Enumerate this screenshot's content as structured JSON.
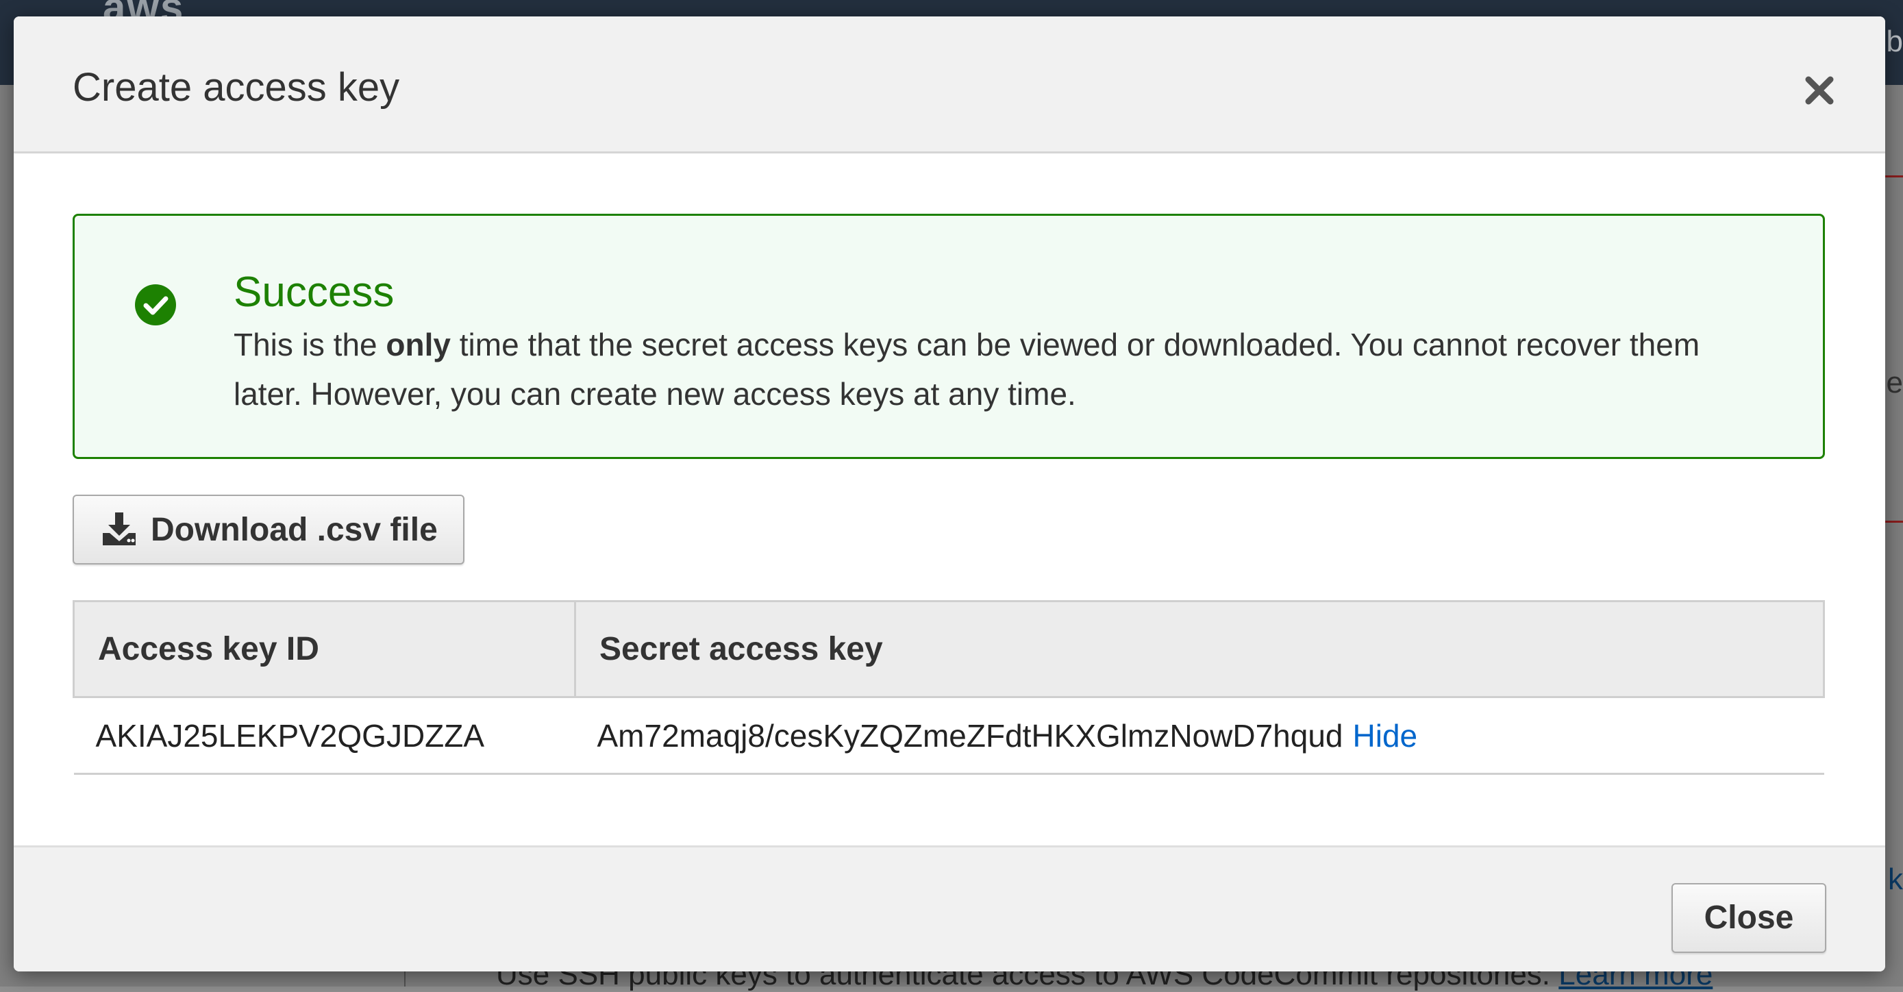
{
  "background": {
    "logo": "aws",
    "topbar_text": "b",
    "side_text": "e",
    "side_link": "k",
    "bottom_text": "Use SSH public keys to authenticate access to AWS CodeCommit repositories.",
    "bottom_link": "Learn more"
  },
  "modal": {
    "title": "Create access key",
    "close_icon": "close-icon",
    "alert": {
      "icon": "check-circle-icon",
      "title": "Success",
      "message_before": "This is the ",
      "message_bold": "only",
      "message_after": " time that the secret access keys can be viewed or downloaded. You cannot recover them later. However, you can create new access keys at any time.",
      "color": "#1d8102"
    },
    "download_button": {
      "icon": "download-icon",
      "label": "Download .csv file"
    },
    "table": {
      "headers": [
        "Access key ID",
        "Secret access key"
      ],
      "rows": [
        {
          "access_key_id": "AKIAJ25LEKPV2QGJDZZA",
          "secret_access_key": "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",
          "toggle_label": "Hide"
        }
      ]
    },
    "footer": {
      "close_label": "Close"
    }
  },
  "colors": {
    "link": "#0066cc",
    "success": "#1d8102",
    "topbar": "#232f3e"
  }
}
